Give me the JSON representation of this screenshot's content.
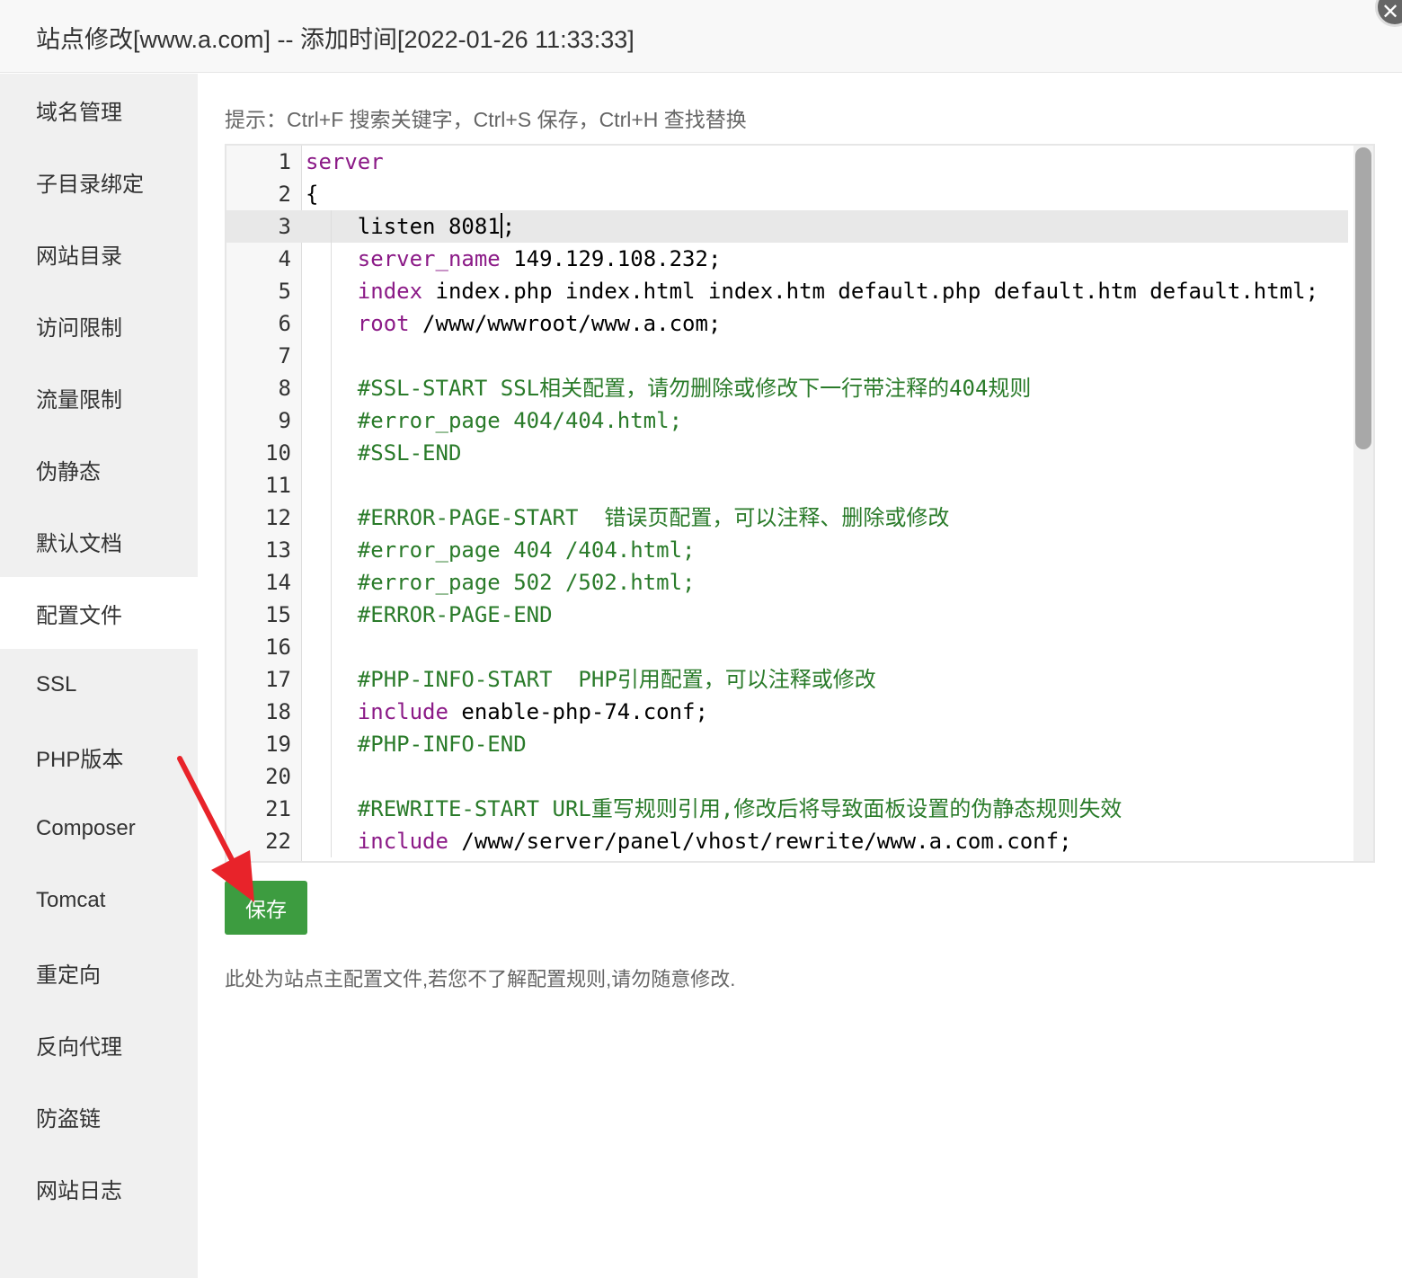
{
  "window": {
    "title": "站点修改[www.a.com] -- 添加时间[2022-01-26 11:33:33]",
    "close_icon": "close-icon"
  },
  "sidebar": {
    "items": [
      {
        "label": "域名管理"
      },
      {
        "label": "子目录绑定"
      },
      {
        "label": "网站目录"
      },
      {
        "label": "访问限制"
      },
      {
        "label": "流量限制"
      },
      {
        "label": "伪静态"
      },
      {
        "label": "默认文档"
      },
      {
        "label": "配置文件",
        "active": true
      },
      {
        "label": "SSL"
      },
      {
        "label": "PHP版本"
      },
      {
        "label": "Composer"
      },
      {
        "label": "Tomcat"
      },
      {
        "label": "重定向"
      },
      {
        "label": "反向代理"
      },
      {
        "label": "防盗链"
      },
      {
        "label": "网站日志"
      }
    ]
  },
  "main": {
    "tip": "提示：Ctrl+F 搜索关键字，Ctrl+S 保存，Ctrl+H 查找替换",
    "save_label": "保存",
    "note": "此处为站点主配置文件,若您不了解配置规则,请勿随意修改.",
    "active_line": 3,
    "editor_lines": [
      {
        "n": "1",
        "kw": "server",
        "rest": ""
      },
      {
        "n": "2",
        "kw": "",
        "rest": "{"
      },
      {
        "n": "3",
        "kw": "",
        "rest": "    listen 8081"
      },
      {
        "n": "4",
        "kw": "    server_name",
        "rest": " 149.129.108.232;"
      },
      {
        "n": "5",
        "kw": "    index",
        "rest": " index.php index.html index.htm default.php default.htm default.html;"
      },
      {
        "n": "6",
        "kw": "    root",
        "rest": " /www/wwwroot/www.a.com;"
      },
      {
        "n": "7",
        "kw": "",
        "rest": ""
      },
      {
        "n": "8",
        "cm": "    #SSL-START SSL相关配置，请勿删除或修改下一行带注释的404规则"
      },
      {
        "n": "9",
        "cm": "    #error_page 404/404.html;"
      },
      {
        "n": "10",
        "cm": "    #SSL-END"
      },
      {
        "n": "11",
        "kw": "",
        "rest": ""
      },
      {
        "n": "12",
        "cm": "    #ERROR-PAGE-START  错误页配置，可以注释、删除或修改"
      },
      {
        "n": "13",
        "cm": "    #error_page 404 /404.html;"
      },
      {
        "n": "14",
        "cm": "    #error_page 502 /502.html;"
      },
      {
        "n": "15",
        "cm": "    #ERROR-PAGE-END"
      },
      {
        "n": "16",
        "kw": "",
        "rest": ""
      },
      {
        "n": "17",
        "cm": "    #PHP-INFO-START  PHP引用配置，可以注释或修改"
      },
      {
        "n": "18",
        "kw": "    include",
        "rest": " enable-php-74.conf;"
      },
      {
        "n": "19",
        "cm": "    #PHP-INFO-END"
      },
      {
        "n": "20",
        "kw": "",
        "rest": ""
      },
      {
        "n": "21",
        "cm": "    #REWRITE-START URL重写规则引用,修改后将导致面板设置的伪静态规则失效"
      },
      {
        "n": "22",
        "kw": "    include",
        "rest": " /www/server/panel/vhost/rewrite/www.a.com.conf;"
      }
    ]
  },
  "colors": {
    "keyword": "#8b1a87",
    "comment": "#2a7b2a",
    "save_button": "#3d9c40",
    "arrow": "#e8232a"
  },
  "annotation_icon": "red-arrow-icon"
}
